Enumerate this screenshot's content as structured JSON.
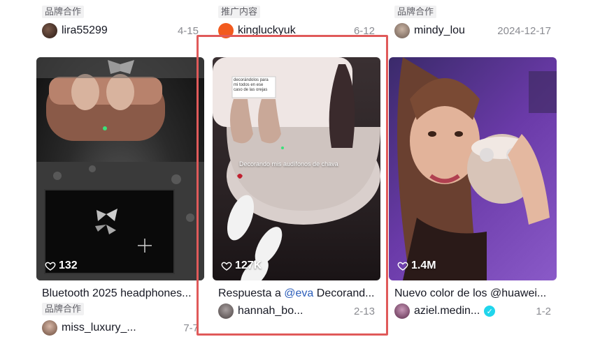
{
  "row_top": [
    {
      "tag": "品牌合作",
      "user": "lira55299",
      "date": "4-15"
    },
    {
      "tag": "推广内容",
      "user": "kingluckyuk",
      "date": "6-12"
    },
    {
      "tag": "品牌合作",
      "user": "mindy_lou",
      "date": "2024-12-17"
    }
  ],
  "row_main": [
    {
      "likes": "132",
      "title": "Bluetooth 2025 headphones...",
      "tag": "品牌合作",
      "user": "miss_luxury_...",
      "date": "7-7"
    },
    {
      "likes": "127K",
      "title_prefix": "Respuesta a ",
      "title_mention": "@eva",
      "title_suffix": " Decorand...",
      "user": "hannah_bo...",
      "date": "2-13",
      "overlay_caption": "Decorando mis audífonos de chava",
      "overlay_note": "decorándolos para mi todos en ese caso de las orejas"
    },
    {
      "likes": "1.4M",
      "title": "Nuevo color de los @huawei...",
      "user": "aziel.medin...",
      "date": "1-2",
      "verified": "✓"
    }
  ],
  "colors": {
    "highlight": "#e05a5a",
    "mention": "#2b5db9",
    "verified": "#20d5ec"
  }
}
